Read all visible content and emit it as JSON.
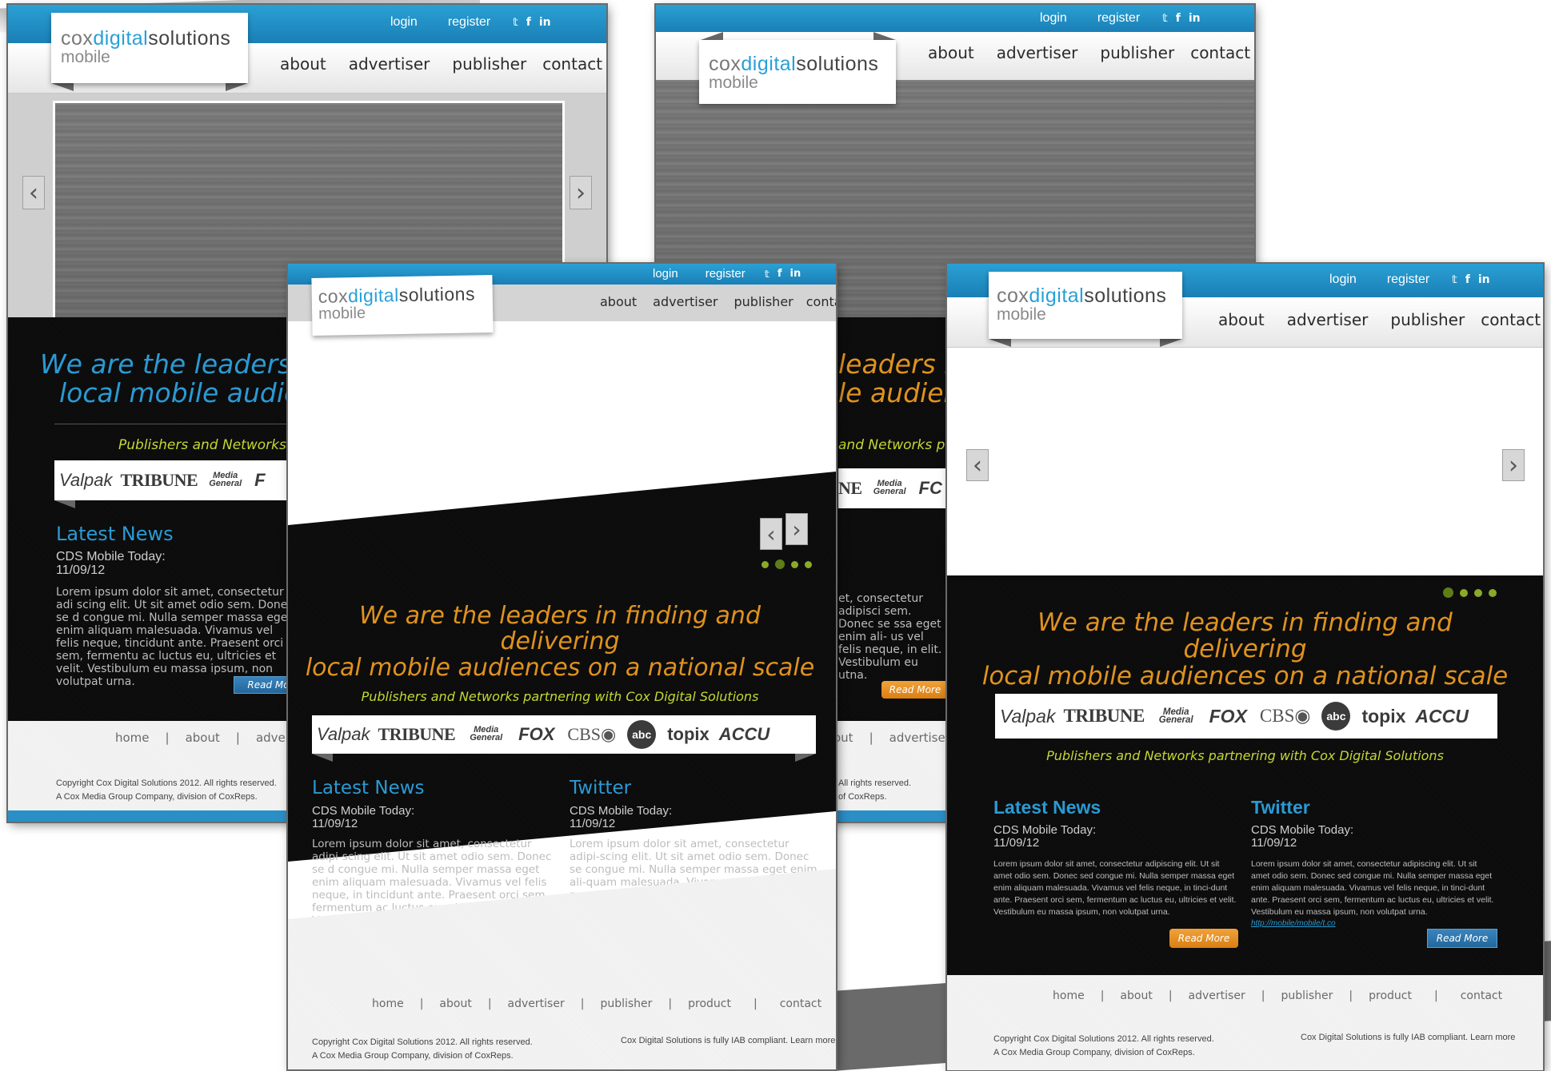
{
  "brand": {
    "cox": "cox",
    "digital": "digital",
    "solutions": "solutions",
    "mobile": "mobile"
  },
  "toplinks": {
    "login": "login",
    "register": "register"
  },
  "social": {
    "twitter": "twitter-icon",
    "facebook": "facebook-icon",
    "linkedin": "linkedin-icon",
    "twitter_glyph": "𝕥",
    "facebook_glyph": "f",
    "linkedin_glyph": "in"
  },
  "nav": {
    "about": "about",
    "advertiser": "advertiser",
    "publisher": "publisher",
    "contact": "contact"
  },
  "arrows": {
    "prev": "‹",
    "next": "›"
  },
  "headline": {
    "line1": "We are the leaders in finding and delivering",
    "line2": "local mobile audiences on a national scale",
    "line1_crop": "We are the leaders i",
    "line2_crop": "local mobile audienc",
    "line1_right": "leaders ir",
    "line2_right": "le audienc"
  },
  "partners": {
    "text": "Publishers and Networks partnering with Cox Digital Solutions",
    "text_crop": "Publishers and Networks pa",
    "text_right": "and Networks part"
  },
  "logos": {
    "valpak": "Valpak",
    "tribune": "TRIBUNE",
    "media1": "Media",
    "media2": "General",
    "fox": "FOX",
    "cbs": "CBS◉",
    "abc": "abc",
    "topix": "topix",
    "accu": "ACCU",
    "ne": "NE",
    "fo": "FC",
    "fcrop": "F"
  },
  "news": {
    "title": "Latest News",
    "head1": "CDS Mobile Today:",
    "date": "11/09/12",
    "body": "Lorem ipsum dolor sit amet, consectetur adipi-scing elit. Ut sit amet odio sem. Donec se d congue mi. Nulla semper massa eget enim aliquam malesuada. Vivamus vel felis neque, in tincidunt ante. Praesent orci sem, fermentum ac luctus eu, ultricies et velit. Vestibulum eu massa ipsum, non volutpat urna.",
    "body_crop": "Lorem ipsum dolor sit amet, consectetur adi scing elit. Ut sit amet odio sem. Donec se d congue mi. Nulla semper massa eget enim aliquam malesuada. Vivamus vel felis neque, tincidunt ante. Praesent orci sem, fermentu ac luctus eu, ultricies et velit. Vestibulum eu massa ipsum, non volutpat urna.",
    "body_right": "et, consectetur adipisci sem. Donec se ssa eget enim ali- us vel felis neque, in elit. Vestibulum eu utna.",
    "body_small": "Lorem ipsum dolor sit amet, consectetur adipiscing elit. Ut sit amet odio sem. Donec sed congue mi. Nulla semper massa eget enim aliquam malesuada. Vivamus vel felis neque, in tinci-dunt ante. Praesent orci sem, fermentum ac luctus eu, ultricies et velit. Vestibulum eu massa ipsum, non volutpat urna."
  },
  "twitter": {
    "title": "Twitter",
    "head1": "CDS Mobile Today:",
    "date": "11/09/12",
    "body": "Lorem ipsum dolor sit amet, consectetur adipi-scing elit. Ut sit amet odio sem. Donec se congue mi. Nulla semper massa eget enim ali-quam malesuada. Vivamus vel felis neque, in tincidunt ante.",
    "body_small": "Lorem ipsum dolor sit amet, consectetur adipiscing elit. Ut sit amet odio sem. Donec sed congue mi. Nulla semper massa eget enim aliquam malesuada. Vivamus vel felis neque, in tinci-dunt ante. Praesent orci sem, fermentum ac luctus eu, ultricies et velit. Vestibulum eu massa ipsum, non volutpat urna.",
    "link": "http://mobile/mobile/t.co"
  },
  "read_more": "Read More",
  "read_more_crop": "Read Mor",
  "footer": {
    "home": "home",
    "about": "about",
    "advertiser": "advertiser",
    "publisher": "publisher",
    "product": "product",
    "contact": "contact",
    "sep": "|",
    "copy1": "Copyright  Cox Digital Solutions 2012. All rights reserved.",
    "copy2": "A Cox Media Group Company, division of CoxReps.",
    "copy1_right": "All rights reserved.",
    "copy2_right": "of CoxReps.",
    "out": "out",
    "iab": "Cox Digital Solutions is fully IAB compliant. Learn more"
  },
  "colors": {
    "blue": "#2a9ad4",
    "orange": "#e0921e",
    "lime": "#c4d832",
    "dark": "#0b0b0b"
  }
}
